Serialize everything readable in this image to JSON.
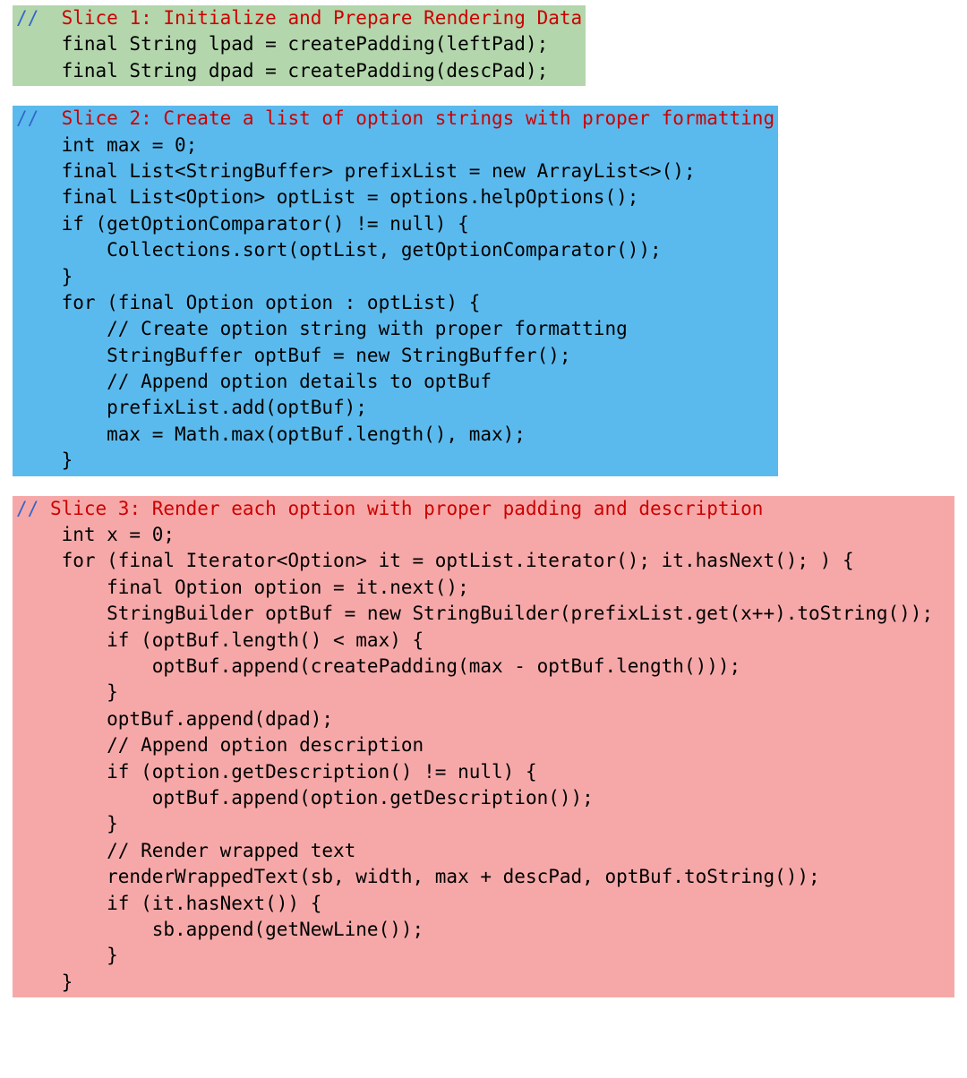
{
  "colors": {
    "slice1_bg": "#b3d6ac",
    "slice2_bg": "#5bbaed",
    "slice3_bg": "#f6a8a8",
    "title_color": "#cc0000",
    "slash_color": "#3366cc"
  },
  "slices": [
    {
      "title_slashes": "//",
      "title_text": "  Slice 1: Initialize and Prepare Rendering Data",
      "body": "    final String lpad = createPadding(leftPad);\n    final String dpad = createPadding(descPad);"
    },
    {
      "title_slashes": "//",
      "title_text": "  Slice 2: Create a list of option strings with proper formatting",
      "body": "    int max = 0;\n    final List<StringBuffer> prefixList = new ArrayList<>();\n    final List<Option> optList = options.helpOptions();\n    if (getOptionComparator() != null) {\n        Collections.sort(optList, getOptionComparator());\n    }\n    for (final Option option : optList) {\n        // Create option string with proper formatting\n        StringBuffer optBuf = new StringBuffer();\n        // Append option details to optBuf\n        prefixList.add(optBuf);\n        max = Math.max(optBuf.length(), max);\n    }"
    },
    {
      "title_slashes": "//",
      "title_text": " Slice 3: Render each option with proper padding and description",
      "body": "    int x = 0;\n    for (final Iterator<Option> it = optList.iterator(); it.hasNext(); ) {\n        final Option option = it.next();\n        StringBuilder optBuf = new StringBuilder(prefixList.get(x++).toString());\n        if (optBuf.length() < max) {\n            optBuf.append(createPadding(max - optBuf.length()));\n        }\n        optBuf.append(dpad);\n        // Append option description\n        if (option.getDescription() != null) {\n            optBuf.append(option.getDescription());\n        }\n        // Render wrapped text\n        renderWrappedText(sb, width, max + descPad, optBuf.toString());\n        if (it.hasNext()) {\n            sb.append(getNewLine());\n        }\n    }"
    }
  ]
}
